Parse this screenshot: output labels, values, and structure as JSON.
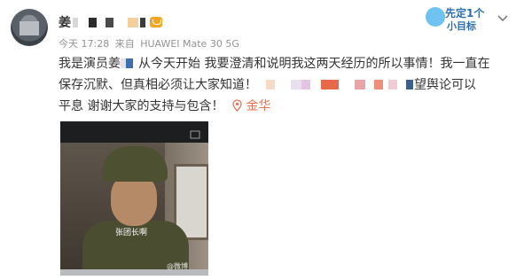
{
  "post": {
    "username": "姜",
    "timestamp": "今天 17:28",
    "source_prefix": "来自",
    "device": "HUAWEI Mate 30 5G",
    "text_line1": "我是演员姜",
    "text_line1b": "从今天开始 我要澄清和说明我这两天经历的所以事情！我一直在",
    "text_line2": "保存沉默、但真相必须让大家知道！",
    "text_line2b": "望舆论可以",
    "text_line3": "平息 谢谢大家的支持与包含！",
    "location": "金华"
  },
  "badge": {
    "line1": "先定1个",
    "line2": "小目标"
  },
  "photo": {
    "subtitle": "张团长啊",
    "watermark": "@微博"
  },
  "colors": {
    "accent_link": "#eb7350",
    "meta_text": "#939393",
    "body_text": "#333333"
  },
  "icons": {
    "dropdown": "chevron-down-icon",
    "location": "location-pin-icon",
    "vip": "vip-badge-icon"
  }
}
